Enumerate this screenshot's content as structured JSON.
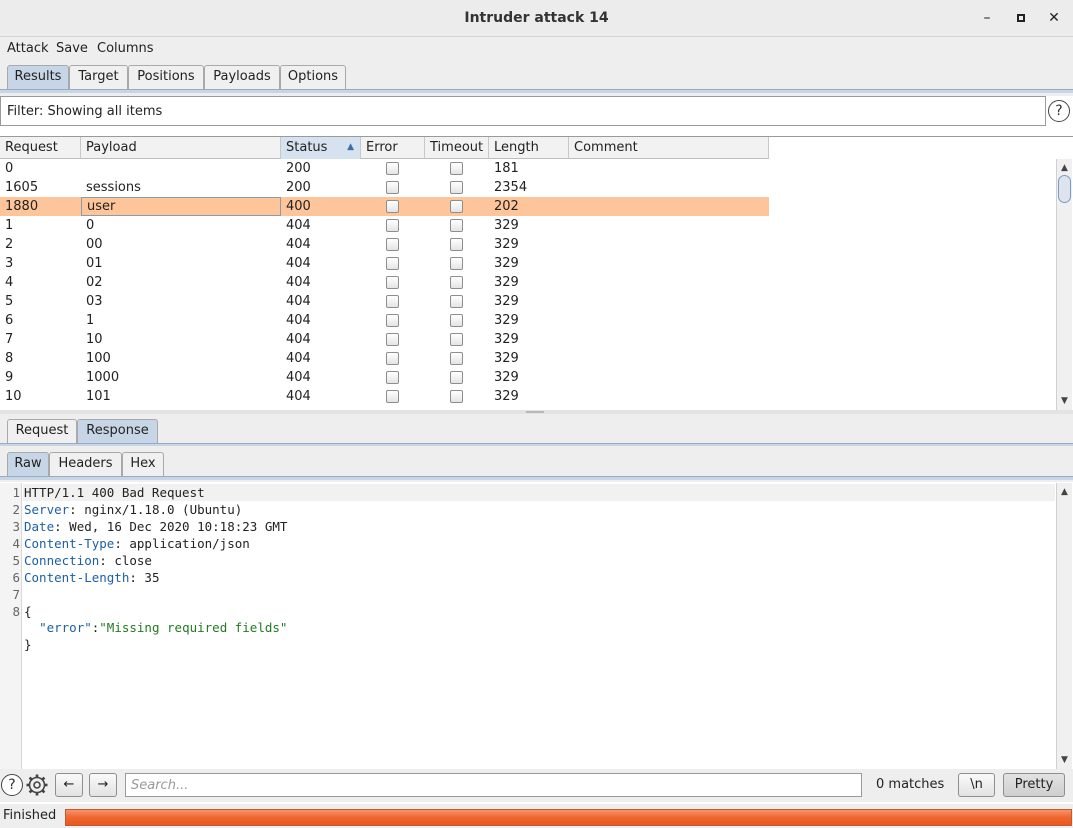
{
  "window": {
    "title": "Intruder attack 14",
    "controls": {
      "minimize": "–",
      "maximize": "◻",
      "close": "✕"
    }
  },
  "menu": {
    "items": [
      "Attack",
      "Save",
      "Columns"
    ]
  },
  "tabs": {
    "items": [
      "Results",
      "Target",
      "Positions",
      "Payloads",
      "Options"
    ],
    "active": "Results"
  },
  "filter": {
    "text": "Filter: Showing all items",
    "help_icon": "?"
  },
  "results_table": {
    "columns": [
      "Request",
      "Payload",
      "Status",
      "Error",
      "Timeout",
      "Length",
      "Comment"
    ],
    "sorted_column": "Status",
    "sort_direction": "ascending",
    "rows": [
      {
        "request": "0",
        "payload": "",
        "status": "200",
        "error": false,
        "timeout": false,
        "length": "181",
        "comment": ""
      },
      {
        "request": "1605",
        "payload": "sessions",
        "status": "200",
        "error": false,
        "timeout": false,
        "length": "2354",
        "comment": ""
      },
      {
        "request": "1880",
        "payload": "user",
        "status": "400",
        "error": false,
        "timeout": false,
        "length": "202",
        "comment": "",
        "selected": true
      },
      {
        "request": "1",
        "payload": "0",
        "status": "404",
        "error": false,
        "timeout": false,
        "length": "329",
        "comment": ""
      },
      {
        "request": "2",
        "payload": "00",
        "status": "404",
        "error": false,
        "timeout": false,
        "length": "329",
        "comment": ""
      },
      {
        "request": "3",
        "payload": "01",
        "status": "404",
        "error": false,
        "timeout": false,
        "length": "329",
        "comment": ""
      },
      {
        "request": "4",
        "payload": "02",
        "status": "404",
        "error": false,
        "timeout": false,
        "length": "329",
        "comment": ""
      },
      {
        "request": "5",
        "payload": "03",
        "status": "404",
        "error": false,
        "timeout": false,
        "length": "329",
        "comment": ""
      },
      {
        "request": "6",
        "payload": "1",
        "status": "404",
        "error": false,
        "timeout": false,
        "length": "329",
        "comment": ""
      },
      {
        "request": "7",
        "payload": "10",
        "status": "404",
        "error": false,
        "timeout": false,
        "length": "329",
        "comment": ""
      },
      {
        "request": "8",
        "payload": "100",
        "status": "404",
        "error": false,
        "timeout": false,
        "length": "329",
        "comment": ""
      },
      {
        "request": "9",
        "payload": "1000",
        "status": "404",
        "error": false,
        "timeout": false,
        "length": "329",
        "comment": ""
      },
      {
        "request": "10",
        "payload": "101",
        "status": "404",
        "error": false,
        "timeout": false,
        "length": "329",
        "comment": ""
      }
    ]
  },
  "message_tabs": {
    "items": [
      "Request",
      "Response"
    ],
    "active": "Response"
  },
  "view_tabs": {
    "items": [
      "Raw",
      "Headers",
      "Hex"
    ],
    "active": "Raw"
  },
  "response": {
    "lines": [
      {
        "n": "1",
        "key": "",
        "value": "HTTP/1.1 400 Bad Request"
      },
      {
        "n": "2",
        "key": "Server",
        "value": " nginx/1.18.0 (Ubuntu)"
      },
      {
        "n": "3",
        "key": "Date",
        "value": " Wed, 16 Dec 2020 10:18:23 GMT"
      },
      {
        "n": "4",
        "key": "Content-Type",
        "value": " application/json"
      },
      {
        "n": "5",
        "key": "Connection",
        "value": " close"
      },
      {
        "n": "6",
        "key": "Content-Length",
        "value": " 35"
      },
      {
        "n": "7",
        "key": "",
        "value": ""
      },
      {
        "n": "8",
        "key": "",
        "value": "{"
      }
    ],
    "json_key": "\"error\"",
    "json_colon": ":",
    "json_value": "\"Missing required fields\"",
    "close_brace": "}"
  },
  "search": {
    "help_icon": "?",
    "settings_icon": "gear-icon",
    "prev_icon": "←",
    "next_icon": "→",
    "placeholder": "Search...",
    "matches": "0 matches",
    "newline_label": "\\n",
    "pretty_label": "Pretty"
  },
  "status": {
    "text": "Finished",
    "progress": 1.0,
    "progress_color": "#f0662f"
  }
}
